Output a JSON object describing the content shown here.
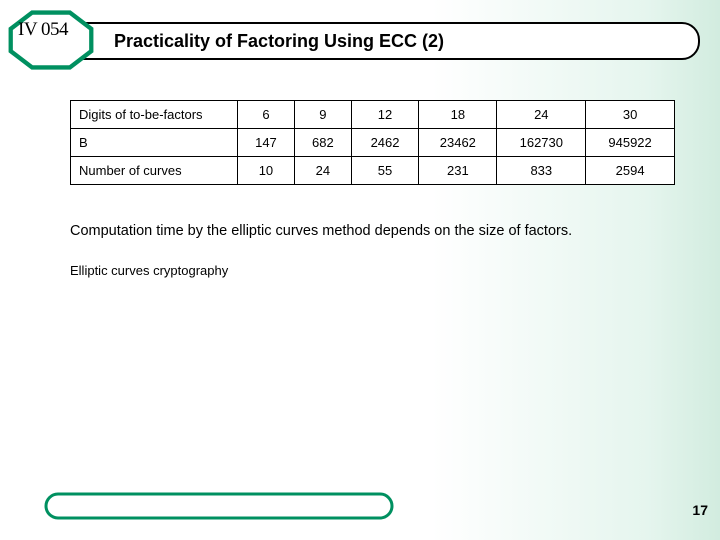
{
  "course_code": "IV 054",
  "title": "Practicality of Factoring Using ECC (2)",
  "table": {
    "rows": [
      {
        "label": "Digits of to-be-factors",
        "cells": [
          "6",
          "9",
          "12",
          "18",
          "24",
          "30"
        ]
      },
      {
        "label": "B",
        "cells": [
          "147",
          "682",
          "2462",
          "23462",
          "162730",
          "945922"
        ]
      },
      {
        "label": "Number of curves",
        "cells": [
          "10",
          "24",
          "55",
          "231",
          "833",
          "2594"
        ]
      }
    ]
  },
  "caption": "Computation time by the elliptic curves method depends on the size of factors.",
  "footer_title": "Elliptic curves cryptography",
  "page_number": "17",
  "chart_data": {
    "type": "table",
    "title": "Practicality of Factoring Using ECC (2)",
    "columns": [
      "Digits of to-be-factors",
      "6",
      "9",
      "12",
      "18",
      "24",
      "30"
    ],
    "rows": [
      [
        "B",
        147,
        682,
        2462,
        23462,
        162730,
        945922
      ],
      [
        "Number of curves",
        10,
        24,
        55,
        231,
        833,
        2594
      ]
    ]
  }
}
